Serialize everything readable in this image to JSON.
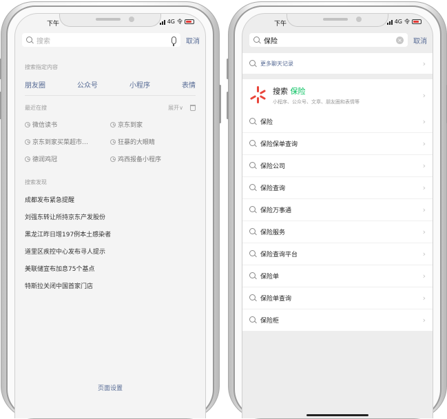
{
  "left": {
    "status": {
      "time": "下午",
      "network": "4G",
      "wifi": "令"
    },
    "search": {
      "placeholder": "搜索",
      "cancel": "取消"
    },
    "filter_title": "搜索指定内容",
    "filter_tabs": [
      "朋友圈",
      "公众号",
      "小程序",
      "表情"
    ],
    "recent": {
      "title": "最近在搜",
      "expand": "展开∨",
      "items": [
        "微信读书",
        "京东到家",
        "京东到家买菜超市…",
        "狂暴的大眼睛",
        "德润鸡冠",
        "鸡西报备小程序"
      ]
    },
    "discover": {
      "title": "搜索发现",
      "items": [
        "成都发布紧急提醒",
        "刘强东转让所持京东产发股份",
        "黑龙江昨日增197例本土感染者",
        "道里区疾控中心发布寻人提示",
        "美联储宣布加息75个基点",
        "特斯拉关闭中国首家门店"
      ]
    },
    "page_settings": "页面设置"
  },
  "right": {
    "status": {
      "time": "下午",
      "network": "4G",
      "wifi": "令"
    },
    "search": {
      "query": "保险",
      "cancel": "取消"
    },
    "chat_record": "更多聊天记录",
    "sou": {
      "prefix": "搜索",
      "keyword": "保险",
      "subtitle": "小程序、公众号、文章、朋友圈和表情等",
      "color": "#e9453a"
    },
    "suggestions": [
      "保险",
      "保险保单查询",
      "保险公司",
      "保险查询",
      "保险万事通",
      "保险服务",
      "保险查询平台",
      "保险单",
      "保险单查询",
      "保险柜"
    ]
  },
  "colors": {
    "link": "#576b95",
    "accent": "#07c160"
  }
}
